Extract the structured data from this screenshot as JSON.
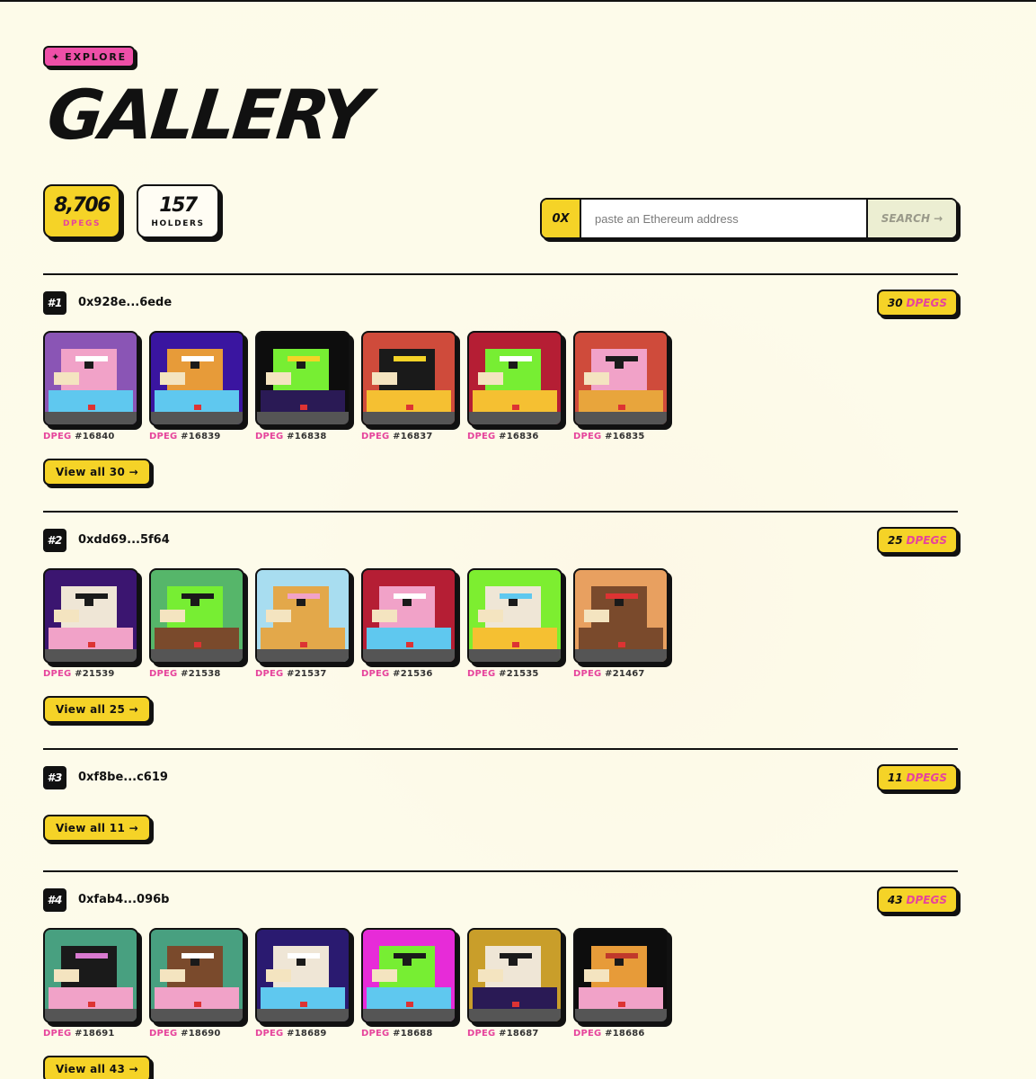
{
  "header": {
    "badge_icon": "✦",
    "badge_label": "EXPLORE",
    "title": "GALLERY"
  },
  "stats": {
    "pegs_value": "8,706",
    "pegs_label": "DPEGS",
    "holders_value": "157",
    "holders_label": "HOLDERS"
  },
  "search": {
    "prefix": "0X",
    "placeholder": "paste an Ethereum address",
    "button_label": "SEARCH →"
  },
  "holders": [
    {
      "rank": "#1",
      "address": "0x928e...6ede",
      "count": "30",
      "count_unit": "DPEGS",
      "view_all": "View all 30 →",
      "pegs": [
        {
          "prefix": "DPEG",
          "id": "#16840",
          "bg": "#8a55b5",
          "body": "#f1a2c8",
          "accent": "#ffffff",
          "base": "#5fc8ef",
          "icon": "pink-bear-icon"
        },
        {
          "prefix": "DPEG",
          "id": "#16839",
          "bg": "#3a15a0",
          "body": "#e79b39",
          "accent": "#ffffff",
          "base": "#5fc8ef",
          "icon": "orange-bear-icon"
        },
        {
          "prefix": "DPEG",
          "id": "#16838",
          "bg": "#0d0d0d",
          "body": "#77ee33",
          "accent": "#f5d327",
          "base": "#2a1a55",
          "icon": "green-frog-crown-icon"
        },
        {
          "prefix": "DPEG",
          "id": "#16837",
          "bg": "#cf4b3b",
          "body": "#1a1a1a",
          "accent": "#f5d327",
          "base": "#f5c032",
          "icon": "black-bird-halo-icon"
        },
        {
          "prefix": "DPEG",
          "id": "#16836",
          "bg": "#b51e34",
          "body": "#77ee33",
          "accent": "#ffffff",
          "base": "#f5c032",
          "icon": "green-frog-icon"
        },
        {
          "prefix": "DPEG",
          "id": "#16835",
          "bg": "#cf4b3b",
          "body": "#f1a2c8",
          "accent": "#1a1a1a",
          "base": "#e8a53c",
          "icon": "pink-wizard-icon"
        }
      ]
    },
    {
      "rank": "#2",
      "address": "0xdd69...5f64",
      "count": "25",
      "count_unit": "DPEGS",
      "view_all": "View all 25 →",
      "pegs": [
        {
          "prefix": "DPEG",
          "id": "#21539",
          "bg": "#3b1570",
          "body": "#efe6d6",
          "accent": "#1a1a1a",
          "base": "#f1a2c8",
          "icon": "white-bird-tophat-icon"
        },
        {
          "prefix": "DPEG",
          "id": "#21538",
          "bg": "#56b66a",
          "body": "#77ee33",
          "accent": "#1a1a1a",
          "base": "#7a4a2c",
          "icon": "green-frog-sunglasses-icon"
        },
        {
          "prefix": "DPEG",
          "id": "#21537",
          "bg": "#a8ddf0",
          "body": "#e3a84a",
          "accent": "#f1a2c8",
          "base": "#e3a84a",
          "icon": "gold-bear-icon"
        },
        {
          "prefix": "DPEG",
          "id": "#21536",
          "bg": "#b51e34",
          "body": "#f1a2c8",
          "accent": "#ffffff",
          "base": "#5fc8ef",
          "icon": "pink-bear-visor-icon"
        },
        {
          "prefix": "DPEG",
          "id": "#21535",
          "bg": "#7dee30",
          "body": "#efe6d6",
          "accent": "#5fc8ef",
          "base": "#f5c032",
          "icon": "white-bear-shades-icon"
        },
        {
          "prefix": "DPEG",
          "id": "#21467",
          "bg": "#e8a060",
          "body": "#7a4a2c",
          "accent": "#d33",
          "base": "#7a4a2c",
          "icon": "brown-bear-icon"
        }
      ]
    },
    {
      "rank": "#3",
      "address": "0xf8be...c619",
      "count": "11",
      "count_unit": "DPEGS",
      "view_all": "View all 11 →",
      "pegs": []
    },
    {
      "rank": "#4",
      "address": "0xfab4...096b",
      "count": "43",
      "count_unit": "DPEGS",
      "view_all": "View all 43 →",
      "pegs": [
        {
          "prefix": "DPEG",
          "id": "#18691",
          "bg": "#48a080",
          "body": "#1a1a1a",
          "accent": "#d97ad0",
          "base": "#f1a2c8",
          "icon": "black-bird-halo-icon"
        },
        {
          "prefix": "DPEG",
          "id": "#18690",
          "bg": "#48a080",
          "body": "#7a4a2c",
          "accent": "#ffffff",
          "base": "#f1a2c8",
          "icon": "brown-bird-icon"
        },
        {
          "prefix": "DPEG",
          "id": "#18689",
          "bg": "#2a1a70",
          "body": "#efe6d6",
          "accent": "#ffffff",
          "base": "#5fc8ef",
          "icon": "white-bird-wizard-icon"
        },
        {
          "prefix": "DPEG",
          "id": "#18688",
          "bg": "#e72bd8",
          "body": "#77ee33",
          "accent": "#1a1a1a",
          "base": "#5fc8ef",
          "icon": "green-frog-sunglasses-icon"
        },
        {
          "prefix": "DPEG",
          "id": "#18687",
          "bg": "#c99e2a",
          "body": "#efe6d6",
          "accent": "#1a1a1a",
          "base": "#2a1a55",
          "icon": "white-bear-shades-icon"
        },
        {
          "prefix": "DPEG",
          "id": "#18686",
          "bg": "#0d0d0d",
          "body": "#e79b39",
          "accent": "#c0392b",
          "base": "#f1a2c8",
          "icon": "orange-devil-icon"
        }
      ]
    }
  ]
}
